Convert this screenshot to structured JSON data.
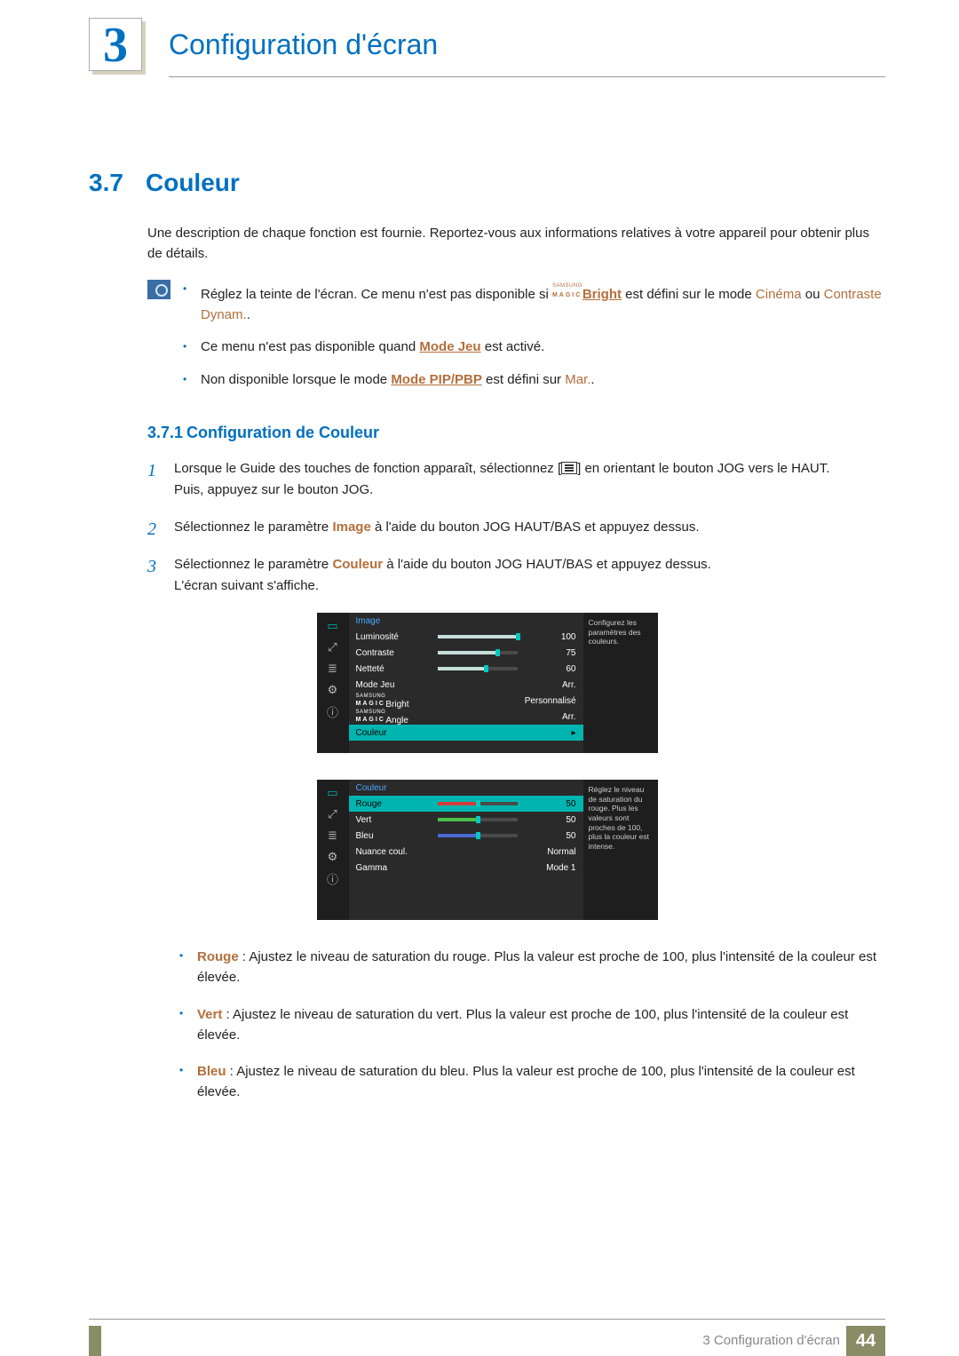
{
  "chapter": {
    "number": "3",
    "title": "Configuration d'écran"
  },
  "section": {
    "number": "3.7",
    "title": "Couleur"
  },
  "intro": "Une description de chaque fonction est fournie. Reportez-vous aux informations relatives à votre appareil pour obtenir plus de détails.",
  "notes": {
    "n1_a": "Réglez la teinte de l'écran. Ce menu n'est pas disponible si ",
    "n1_magic_top": "SAMSUNG",
    "n1_magic_bot": "MAGIC",
    "n1_bright": "Bright",
    "n1_b": " est défini sur le mode ",
    "n1_c": "Cinéma",
    "n1_or": " ou ",
    "n1_d": "Contraste Dynam.",
    "n1_e": ".",
    "n2_a": "Ce menu n'est pas disponible quand ",
    "n2_b": "Mode Jeu",
    "n2_c": " est activé.",
    "n3_a": "Non disponible lorsque le mode ",
    "n3_b": "Mode PIP/PBP",
    "n3_c": " est défini sur ",
    "n3_d": "Mar.",
    "n3_e": "."
  },
  "subsection": {
    "number": "3.7.1",
    "title": "Configuration de Couleur"
  },
  "steps": {
    "s1a": "Lorsque le Guide des touches de fonction apparaît, sélectionnez [",
    "s1b": "] en orientant le bouton JOG vers le HAUT.",
    "s1c": "Puis, appuyez sur le bouton JOG.",
    "s2a": "Sélectionnez le paramètre ",
    "s2b": "Image",
    "s2c": " à l'aide du bouton JOG HAUT/BAS et appuyez dessus.",
    "s3a": "Sélectionnez le paramètre ",
    "s3b": "Couleur",
    "s3c": " à l'aide du bouton JOG HAUT/BAS et appuyez dessus.",
    "s3d": "L'écran suivant s'affiche."
  },
  "osd1": {
    "title": "Image",
    "hint": "Configurez les paramètres des couleurs.",
    "rows": [
      {
        "label": "Luminosité",
        "value": "100",
        "fill": 100
      },
      {
        "label": "Contraste",
        "value": "75",
        "fill": 75
      },
      {
        "label": "Netteté",
        "value": "60",
        "fill": 60
      },
      {
        "label": "Mode Jeu",
        "value": "Arr."
      },
      {
        "label": "MAGICBright",
        "value": "Personnalisé",
        "magic": true
      },
      {
        "label": "MAGICAngle",
        "value": "Arr.",
        "magic": true
      }
    ],
    "selected": "Couleur"
  },
  "osd2": {
    "title": "Couleur",
    "hint": "Réglez le niveau de saturation du rouge. Plus les valeurs sont proches de 100, plus la couleur est intense.",
    "rows": [
      {
        "label": "Rouge",
        "value": "50",
        "fill": 50,
        "sel": true,
        "color": "#d43b3b"
      },
      {
        "label": "Vert",
        "value": "50",
        "fill": 50,
        "color": "#4ac24a"
      },
      {
        "label": "Bleu",
        "value": "50",
        "fill": 50,
        "color": "#4a6ad4"
      },
      {
        "label": "Nuance coul.",
        "value": "Normal"
      },
      {
        "label": "Gamma",
        "value": "Mode 1"
      }
    ]
  },
  "desc": {
    "d1l": "Rouge",
    "d1t": " : Ajustez le niveau de saturation du rouge. Plus la valeur est proche de 100, plus l'intensité de la couleur est élevée.",
    "d2l": "Vert",
    "d2t": " : Ajustez le niveau de saturation du vert. Plus la valeur est proche de 100, plus l'intensité de la couleur est élevée.",
    "d3l": "Bleu",
    "d3t": " : Ajustez le niveau de saturation du bleu. Plus la valeur est proche de 100, plus l'intensité de la couleur est élevée."
  },
  "footer": {
    "text": "3 Configuration d'écran",
    "page": "44"
  }
}
